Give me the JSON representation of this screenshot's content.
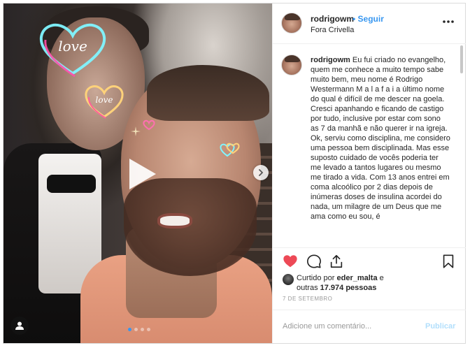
{
  "post": {
    "username": "rodrigowm",
    "follow_label": "Seguir",
    "separator": "•",
    "location": "Fora Crivella",
    "more_icon": "more-horizontal-icon"
  },
  "media": {
    "sticker_large": "love",
    "sticker_small": "love",
    "carousel_dots": 4,
    "active_dot": 0
  },
  "caption": {
    "username": "rodrigowm",
    "text": "Eu fui criado no evangelho, quem me conhece a muito tempo sabe muito bem, meu nome é Rodrigo Westermann M a l a f a i a último nome do qual é difícil de me descer na goela. Cresci apanhando e ficando de castigo por tudo, inclusive por estar com sono as 7 da manhã e não querer ir na igreja. Ok, serviu como disciplina, me considero uma pessoa bem disciplinada. Mas esse suposto cuidado de vocês poderia ter me levado a tantos lugares ou mesmo me tirado a vida. Com 13 anos entrei em coma alcoólico por 2 dias depois de inúmeras doses de insulina acordei do nada, um milagre de um Deus que me ama como eu sou, é"
  },
  "likes": {
    "line1_prefix": "Curtido por ",
    "line1_user": "eder_malta",
    "line1_suffix": " e",
    "line2_prefix": "outras ",
    "line2_count": "17.974 pessoas"
  },
  "date": "7 DE SETEMBRO",
  "comment": {
    "placeholder": "Adicione um comentário...",
    "publish_label": "Publicar"
  },
  "colors": {
    "accent": "#3897f0",
    "like_red": "#ed4956",
    "publish_disabled": "#b2dffc"
  }
}
